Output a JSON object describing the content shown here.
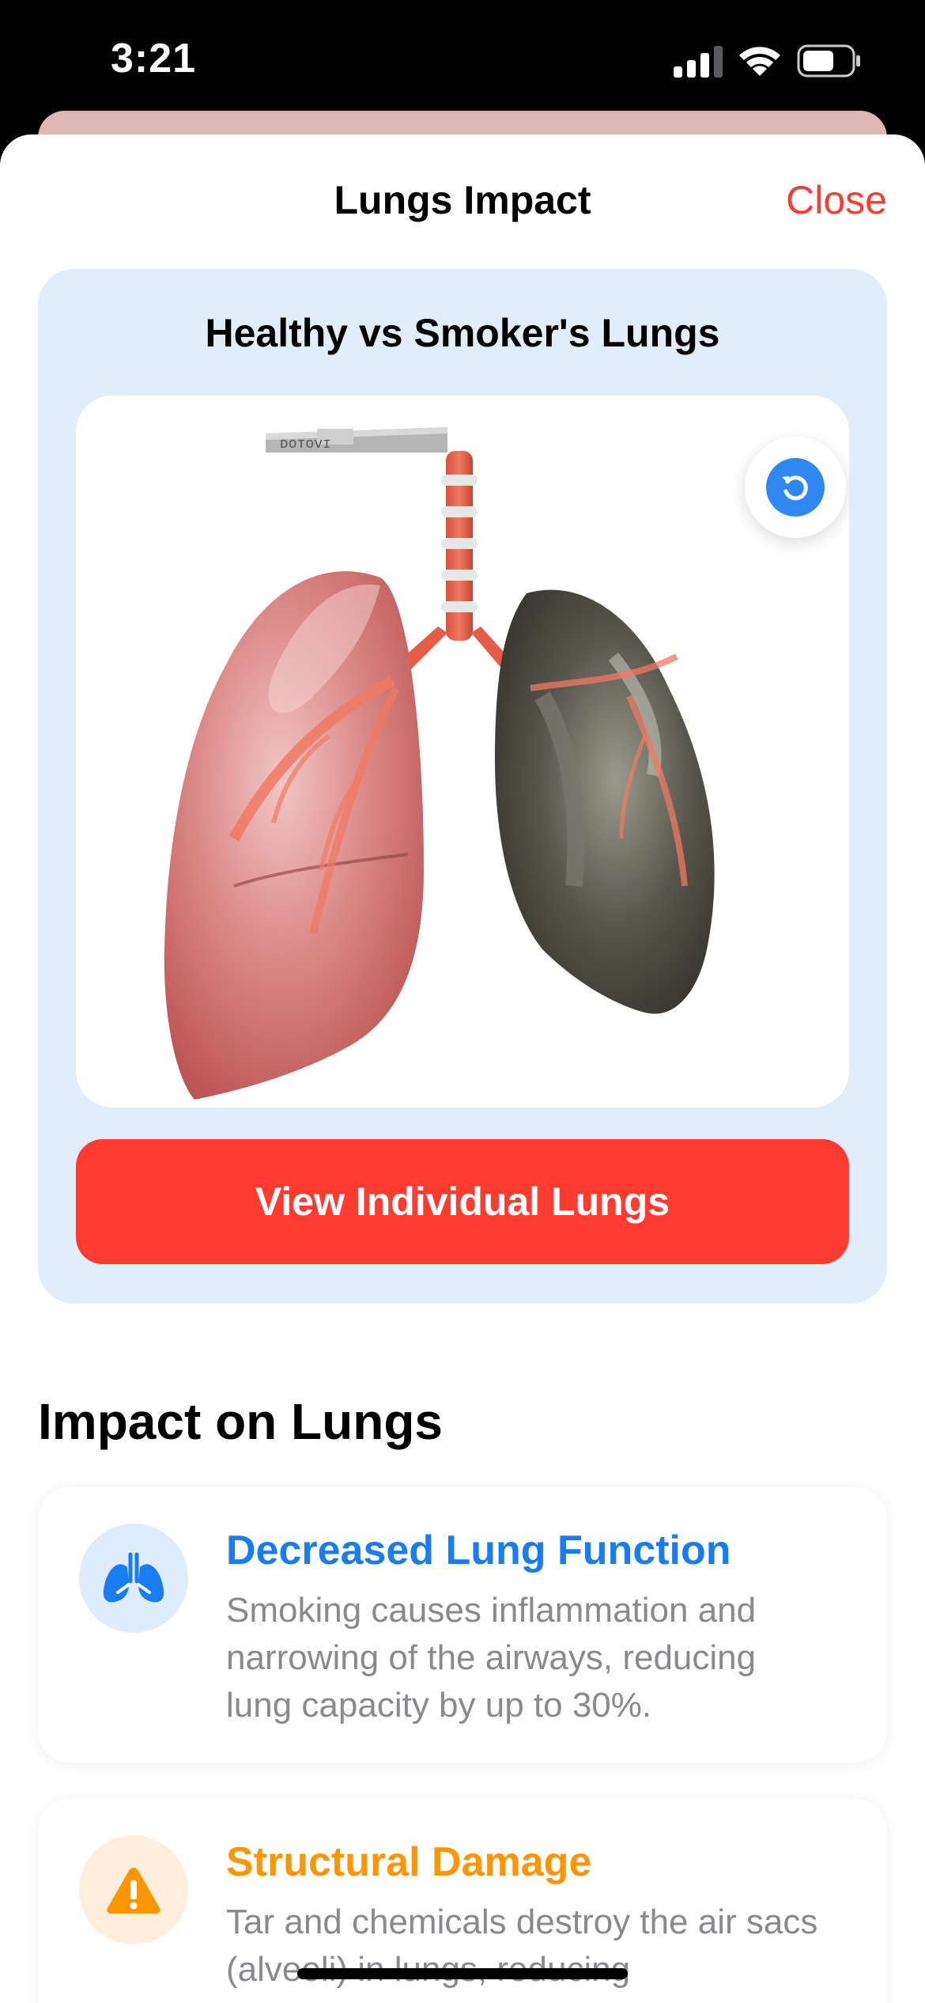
{
  "status_bar": {
    "time": "3:21"
  },
  "header": {
    "title": "Lungs Impact",
    "close_label": "Close"
  },
  "viewer": {
    "title": "Healthy vs Smoker's Lungs",
    "button_label": "View Individual Lungs",
    "reset_icon": "rotate-ccw-icon",
    "model_stand_text": "ᴅᴏᴛᴏᴠɪ"
  },
  "section": {
    "title": "Impact on Lungs"
  },
  "impacts": [
    {
      "heading": "Decreased Lung Function",
      "text": "Smoking causes inflammation and narrowing of the airways, reducing lung capacity by up to 30%.",
      "icon": "lungs-icon",
      "color": "#1a7cf2",
      "bg": "#deecfd"
    },
    {
      "heading": "Structural Damage",
      "text": "Tar and chemicals destroy the air sacs (alveoli) in lungs, reducing",
      "icon": "warning-icon",
      "color": "#ff9500",
      "bg": "#ffeedb"
    }
  ],
  "colors": {
    "accent_red": "#ff3b30",
    "accent_blue": "#2f88f0",
    "viewer_bg": "#e1edfb"
  }
}
